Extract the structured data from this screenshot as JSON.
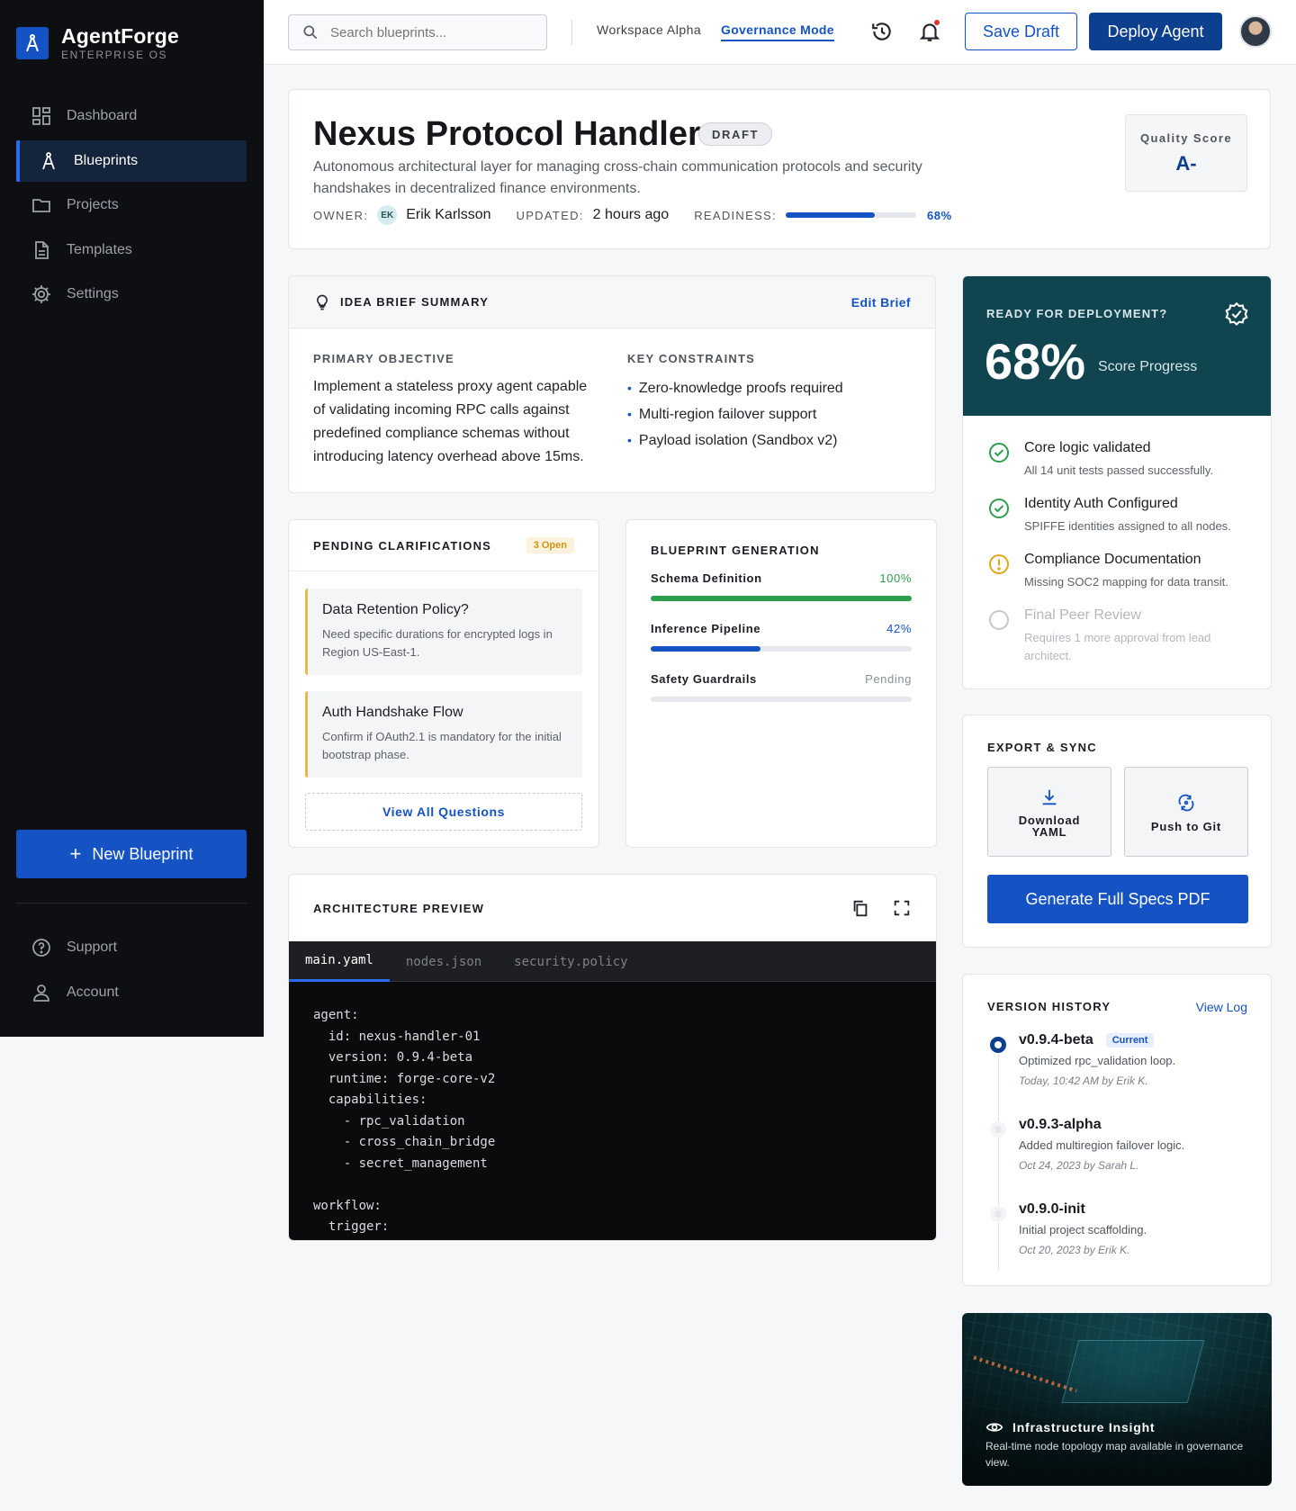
{
  "brand": {
    "name": "AgentForge",
    "subtitle": "ENTERPRISE OS",
    "accent": "#1553c4",
    "logo_icon": "compass-icon"
  },
  "sidebar": {
    "items": [
      {
        "label": "Dashboard",
        "icon": "dashboard-icon",
        "active": false
      },
      {
        "label": "Blueprints",
        "icon": "compass-icon",
        "active": true
      },
      {
        "label": "Projects",
        "icon": "folder-icon",
        "active": false
      },
      {
        "label": "Templates",
        "icon": "document-icon",
        "active": false
      },
      {
        "label": "Settings",
        "icon": "gear-icon",
        "active": false
      }
    ],
    "new_blueprint": "New Blueprint",
    "bottom": [
      {
        "label": "Support",
        "icon": "help-icon"
      },
      {
        "label": "Account",
        "icon": "user-icon"
      }
    ]
  },
  "topbar": {
    "search_placeholder": "Search blueprints...",
    "workspace": "Workspace Alpha",
    "mode": "Governance Mode",
    "save_draft": "Save Draft",
    "deploy": "Deploy Agent"
  },
  "header": {
    "title": "Nexus Protocol Handler",
    "status": "DRAFT",
    "description": "Autonomous architectural layer for managing cross-chain communication protocols and security handshakes in decentralized finance environments.",
    "owner_label": "OWNER:",
    "owner_initials": "EK",
    "owner_name": "Erik Karlsson",
    "updated_label": "UPDATED:",
    "updated_value": "2 hours ago",
    "readiness_label": "READINESS:",
    "readiness_text": "68%",
    "readiness_value": 0.68,
    "quality_label": "Quality Score",
    "quality_value": "A-"
  },
  "brief": {
    "title": "IDEA BRIEF SUMMARY",
    "edit": "Edit Brief",
    "objective_label": "PRIMARY OBJECTIVE",
    "objective": "Implement a stateless proxy agent capable of validating incoming RPC calls against predefined compliance schemas without introducing latency overhead above 15ms.",
    "constraints_label": "KEY CONSTRAINTS",
    "constraints": [
      "Zero-knowledge proofs required",
      "Multi-region failover support",
      "Payload isolation (Sandbox v2)"
    ]
  },
  "clarifications": {
    "title": "PENDING CLARIFICATIONS",
    "badge": "3 Open",
    "items": [
      {
        "title": "Data Retention Policy?",
        "desc": "Need specific durations for encrypted logs in Region US-East-1."
      },
      {
        "title": "Auth Handshake Flow",
        "desc": "Confirm if OAuth2.1 is mandatory for the initial bootstrap phase."
      }
    ],
    "view_all": "View All Questions"
  },
  "generation": {
    "title": "BLUEPRINT GENERATION",
    "rows": [
      {
        "name": "Schema Definition",
        "status": "100%",
        "value": 1.0,
        "color": "#2e9e4f"
      },
      {
        "name": "Inference Pipeline",
        "status": "42%",
        "value": 0.42,
        "color": "#1553c4"
      },
      {
        "name": "Safety Guardrails",
        "status": "Pending",
        "value": 0,
        "color": "#8a8f98"
      }
    ]
  },
  "architecture": {
    "title": "ARCHITECTURE PREVIEW",
    "tabs": [
      "main.yaml",
      "nodes.json",
      "security.policy"
    ],
    "code": [
      "agent:",
      "  id: nexus-handler-01",
      "  version: 0.9.4-beta",
      "  runtime: forge-core-v2",
      "  capabilities:",
      "    - rpc_validation",
      "    - cross_chain_bridge",
      "    - secret_management",
      "",
      "workflow:",
      "  trigger:"
    ]
  },
  "deployment": {
    "label": "READY FOR DEPLOYMENT?",
    "percent": "68%",
    "progress_label": "Score Progress",
    "color": "#10454f",
    "checks": [
      {
        "title": "Core logic validated",
        "desc": "All 14 unit tests passed successfully.",
        "state": "done"
      },
      {
        "title": "Identity Auth Configured",
        "desc": "SPIFFE identities assigned to all nodes.",
        "state": "done"
      },
      {
        "title": "Compliance Documentation",
        "desc": "Missing SOC2 mapping for data transit.",
        "state": "warning"
      },
      {
        "title": "Final Peer Review",
        "desc": "Requires 1 more approval from lead architect.",
        "state": "pending"
      }
    ]
  },
  "export": {
    "title": "EXPORT & SYNC",
    "download": "Download YAML",
    "push": "Push to Git",
    "generate": "Generate Full Specs PDF"
  },
  "versions": {
    "title": "VERSION HISTORY",
    "view_log": "View Log",
    "items": [
      {
        "name": "v0.9.4-beta",
        "badge": "Current",
        "desc": "Optimized rpc_validation loop.",
        "when": "Today, 10:42 AM by Erik K."
      },
      {
        "name": "v0.9.3-alpha",
        "badge": "",
        "desc": "Added multiregion failover logic.",
        "when": "Oct 24, 2023 by Sarah L."
      },
      {
        "name": "v0.9.0-init",
        "badge": "",
        "desc": "Initial project scaffolding.",
        "when": "Oct 20, 2023 by Erik K."
      }
    ]
  },
  "insight": {
    "title": "Infrastructure Insight",
    "desc": "Real-time node topology map available in governance view."
  }
}
